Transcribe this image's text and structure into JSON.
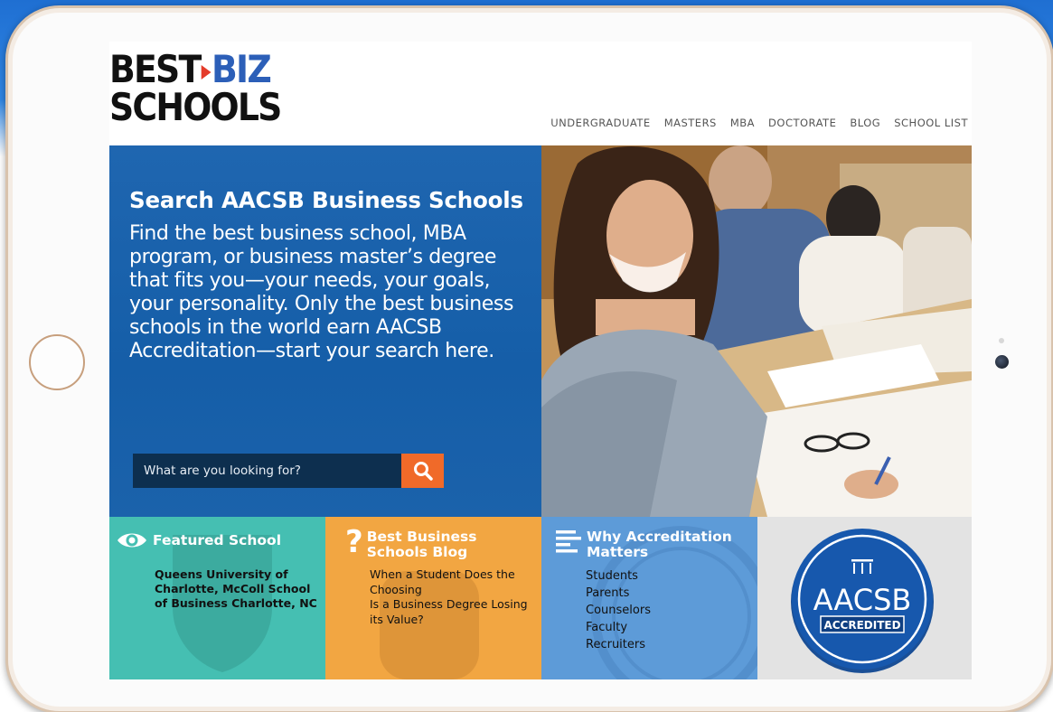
{
  "logo": {
    "line1_a": "BEST",
    "line1_b": "BIZ",
    "line2": "SCHOOLS"
  },
  "nav": {
    "items": [
      "UNDERGRADUATE",
      "MASTERS",
      "MBA",
      "DOCTORATE",
      "BLOG",
      "SCHOOL LIST"
    ]
  },
  "hero": {
    "title": "Search AACSB Business Schools",
    "description": "Find the best business school, MBA program, or business master’s degree that fits you—your needs, your goals, your personality. Only the best business schools in the world earn AACSB Accreditation—start your search here.",
    "search_placeholder": "What are you looking for?"
  },
  "cards": {
    "featured": {
      "title": "Featured School",
      "school": "Queens University of Charlotte, McColl School of Business Charlotte, NC"
    },
    "blog": {
      "title_line1": "Best Business",
      "title_line2": "Schools Blog",
      "posts": [
        "When a Student Does the Choosing",
        "Is a Business Degree Losing its Value?"
      ]
    },
    "accreditation": {
      "title_line1": "Why Accreditation",
      "title_line2": "Matters",
      "links": [
        "Students",
        "Parents",
        "Counselors",
        "Faculty",
        "Recruiters"
      ]
    },
    "badge": {
      "name": "AACSB",
      "label": "ACCREDITED"
    }
  },
  "colors": {
    "hero_blue": "#155ea8",
    "search_orange": "#f06a29",
    "teal": "#45bfb2",
    "orange": "#f2a642",
    "light_blue": "#5d9bd8",
    "badge_blue": "#1656a8"
  }
}
